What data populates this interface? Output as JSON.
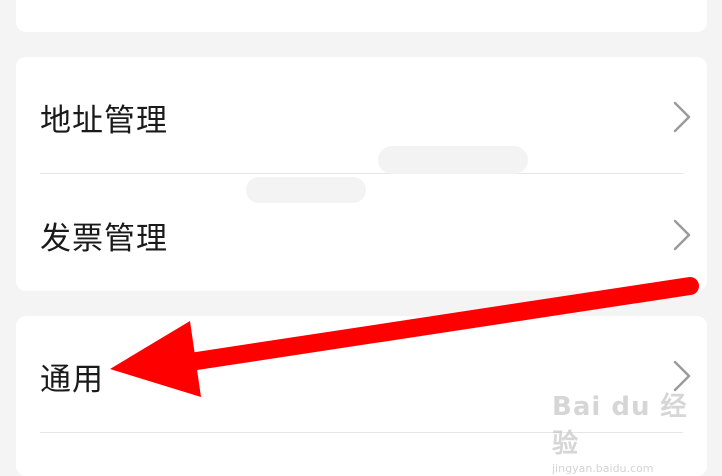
{
  "settings": {
    "items": [
      {
        "label": "地址管理"
      },
      {
        "label": "发票管理"
      },
      {
        "label": "通用"
      }
    ]
  },
  "watermark": {
    "main": "Bai du 经验",
    "sub": "jingyan.baidu.com"
  },
  "colors": {
    "background": "#f4f4f4",
    "card": "#ffffff",
    "arrow": "#ff0000",
    "divider": "#e6e6e6",
    "chevron": "#9a9a9a"
  },
  "icons": {
    "chevron": "chevron-right-icon"
  }
}
